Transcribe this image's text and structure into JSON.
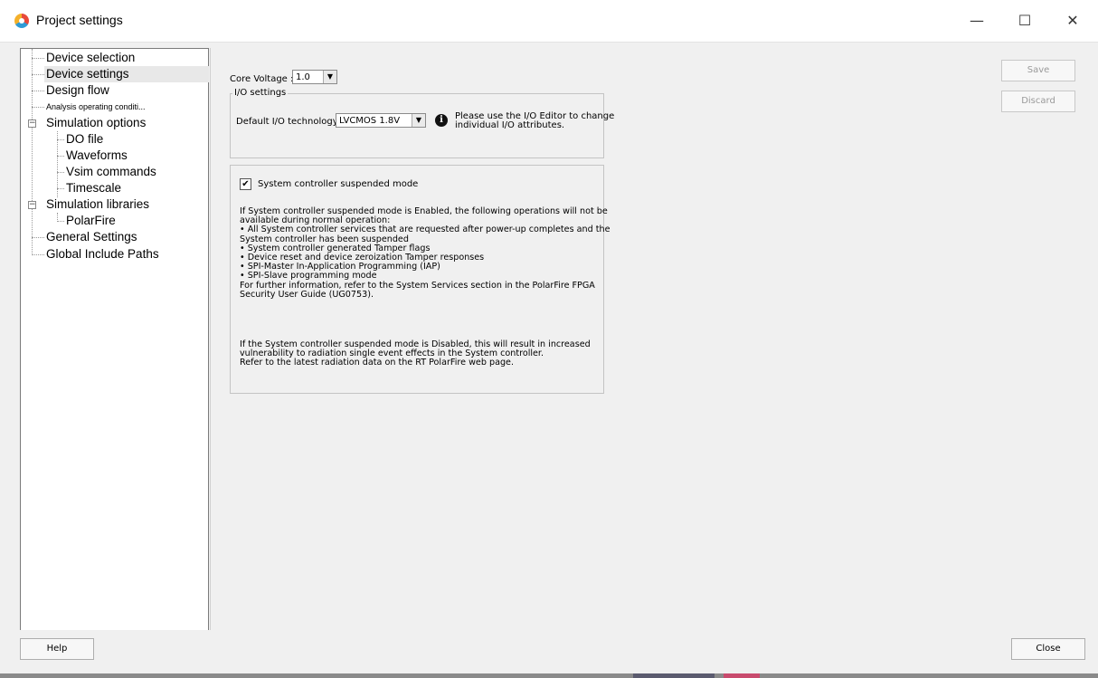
{
  "window": {
    "title": "Project settings",
    "controls": {
      "minimize": "—",
      "maximize": "☐",
      "close": "✕"
    }
  },
  "tree": {
    "items": [
      {
        "label": "Device selection",
        "level": 1
      },
      {
        "label": "Device settings",
        "level": 1,
        "selected": true
      },
      {
        "label": "Design flow",
        "level": 1
      },
      {
        "label": "Analysis operating conditi...",
        "level": 1
      },
      {
        "label": "Simulation options",
        "level": 1,
        "expandable": true
      },
      {
        "label": "DO file",
        "level": 2
      },
      {
        "label": "Waveforms",
        "level": 2
      },
      {
        "label": "Vsim commands",
        "level": 2
      },
      {
        "label": "Timescale",
        "level": 2
      },
      {
        "label": "Simulation libraries",
        "level": 1,
        "expandable": true
      },
      {
        "label": "PolarFire",
        "level": 2
      },
      {
        "label": "General Settings",
        "level": 1
      },
      {
        "label": "Global Include Paths",
        "level": 1
      }
    ]
  },
  "core_voltage": {
    "label": "Core Voltage :",
    "value": "1.0"
  },
  "io_settings": {
    "title": "I/O settings",
    "default_tech_label": "Default I/O technology:",
    "default_tech_value": "LVCMOS 1.8V",
    "note_line1": "Please use the I/O Editor to change",
    "note_line2": "individual I/O attributes."
  },
  "system_controller": {
    "checkbox_label": "System controller suspended mode",
    "checked": true,
    "text_lines": [
      "If System controller suspended mode is Enabled, the following operations will not be",
      "available during normal operation:",
      "  • All System controller services that are requested after power-up completes and the",
      "System controller has been suspended",
      "  • System controller generated Tamper flags",
      "  • Device reset and device zeroization Tamper responses",
      "  • SPI-Master In-Application Programming (IAP)",
      "  • SPI-Slave programming mode",
      "For further information, refer to the System Services section in the PolarFire FPGA",
      "Security User Guide (UG0753)."
    ],
    "text_lines_2": [
      "If the System controller suspended mode is Disabled, this will result in increased",
      "vulnerability to radiation single event effects in the System controller.",
      "Refer to the latest radiation data on the RT PolarFire web page."
    ]
  },
  "buttons": {
    "save": "Save",
    "discard": "Discard",
    "help": "Help",
    "close": "Close"
  }
}
